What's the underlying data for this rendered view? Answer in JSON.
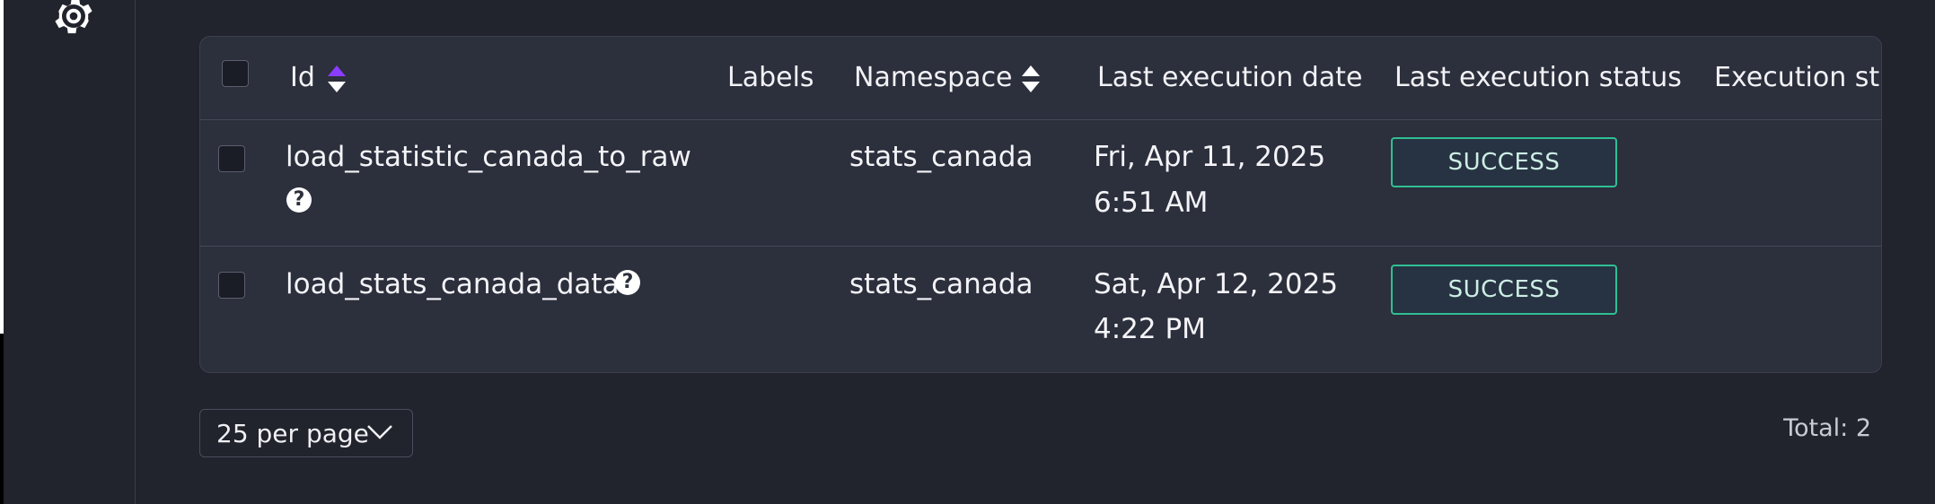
{
  "table": {
    "columns": [
      {
        "label": "Id",
        "sortable": true
      },
      {
        "label": "Labels",
        "sortable": false
      },
      {
        "label": "Namespace",
        "sortable": true
      },
      {
        "label": "Last execution date",
        "sortable": false
      },
      {
        "label": "Last execution status",
        "sortable": false
      },
      {
        "label": "Execution st",
        "sortable": false
      }
    ],
    "rows": [
      {
        "id": "load_statistic_canada_to_raw",
        "namespace": "stats_canada",
        "date_line1": "Fri, Apr 11, 2025",
        "date_line2": "6:51 AM",
        "status": "SUCCESS"
      },
      {
        "id": "load_stats_canada_data",
        "namespace": "stats_canada",
        "date_line1": "Sat, Apr 12, 2025",
        "date_line2": "4:22 PM",
        "status": "SUCCESS"
      }
    ],
    "help_glyph": "?"
  },
  "pagination": {
    "per_page_label": "25 per page",
    "total_label": "Total: 2"
  },
  "colors": {
    "background": "#21232d",
    "card": "#2c2f3c",
    "success": "#2fbf94",
    "sort_active": "#8b3dff"
  },
  "icons": {
    "sidebar": "gear-icon",
    "sort": "sort-icon",
    "help": "help-icon",
    "dropdown": "chevron-down-icon"
  }
}
